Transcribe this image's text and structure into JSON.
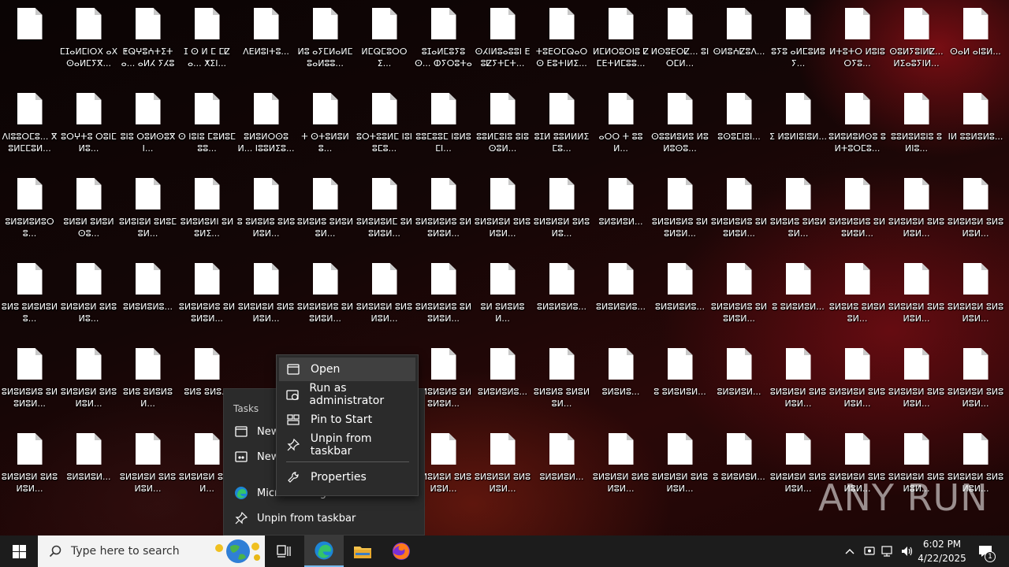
{
  "desktop": {
    "rows": [
      [
        "",
        "ⵎⵊⴰⵍⵎⵏⵔⵝ ⴰⵝⵙⴰⵍⵎⵢⴳ...",
        "ⵟⵕⵖⵓⵄⵜⵉⵜⴰ... ⴰⵍⵃ ⵢⵃⵓⵃⵕ...",
        "ⵊ ⵙ ⵍ ⵎ ⵎⵇⴰ... ⵅⵉⵏ...",
        "ⴷⴹⵍⵓⵏⵜⵓ...",
        "ⵍⵓ ⴰⵢⵎⵍⴰⵍⵎⵓⴰⵍⵓⵓ...",
        "ⵍⵎⵕⵎⵓⵔⵔⵉ...",
        "ⵓⵊⴰⵍⵎⵓⵢⵓⵙ... ⵀⵢⵔⵓⵜⴰⵍ...",
        "ⵙⵃⵏⵍⵓⴰⵓⵓⵏ ⴹⵓⵇⵢⵜⵎⵜ...",
        "ⵜⵓⴹⵔⵎⵕⴰⵔⵙ ⴹⵓⵜⵏⵍⵉ...",
        "ⵍⵎⵍⵔⵓⵔⵏⵓ ⵇⵎⴹⵜⵍⵎⵓⵓ...",
        "ⵍⵙⵓⴹⵔⵇ... ⵓⵏⵔⵎⵍ...",
        "ⵙⵍⵓⵄⵇⵓⴷ...",
        "ⵓⵢⵓ ⴰⵍⵎⵓⵍⵓⵢ...",
        "ⵍⵜⵓⵜⵔ ⵍⵓⵏⵓⵔⵢⵓ...",
        "ⵙⵓⵍⵢⵓⵏⵍⵇ... ⵍⵉⴰⵓⵢⵏⵍ...",
        "ⵙⴰⵍ ⴰⵏⵓⵍ..."
      ],
      [
        "ⴷⵏⵓⵓⵔⵎⵓ... ⴳⵓⵍⵎⵎⵓⵍ...",
        "ⵓⵔⵖⵜⵓ ⵔⵓⵏⵎⵍⵓ...",
        "ⵓⵏⵓ ⵔⵓⵍⵙⵓⴳⵏ...",
        "ⵙ ⵏⵓⵏⵓ ⵎⵓⵍⵓⵎⵓⵓ...",
        "ⵓⵍⵓⵍⵔⵙⵓⵍ... ⵏⵓⵓⵍⵉⵓ...",
        "ⵜ ⵙⵜⵓⵍⵓⵍⵓ...",
        "ⵓⵔⵜⵓⵓⵍⵎ ⵏⵓⵏⵓⵎⵓ...",
        "ⵓⵓⵎⵓⵓⵎ ⵏⵓⵍⵓⵎⵏ...",
        "ⵓⵓⵍⵎⵓⵏⵓ ⵓⵏⵓⵙⵓⵍ...",
        "ⵓⵊⵍ ⵓⵓⵍⵍⵍⵉⵎⵓ...",
        "ⴰⵔⵔ ⵜ ⵓⵓⵍ...",
        "ⵙⵓⵓⵍⵓⵍⵓ ⵍⵓⵍⵓⵙⵓ...",
        "ⵓⵙⵓⵎⵏⵓⵏ...",
        "ⵉ ⵍⵓⵍⵏⵓⵏⵓⵍ...",
        "ⵓⵍⵓⵍⵓⵍⵙⵓ ⵓⵍⵜⵓⵔⵎⵓ...",
        "ⵓⵓⵍⵓⵍⵓⵏⵓ ⵓ ⵍⵏⵓ...",
        "ⵏⵍ ⵓⵓⵍⵓⵍⵓ..."
      ],
      [
        "ⵓⵍⵓⵍⵓⵍⵓⵔⵓ...",
        "ⵓⵍⵓⵍ ⵓⵍⵓⵍⵙⵓ...",
        "ⵓⵍⵓⵏⵓⵍ ⵓⵍⵓⵎⵓⵍ...",
        "ⵓⵍⵓⵍⵓⵍⵏ ⵓⵍⵓⵍⵉ...",
        "ⵓ ⵓⵍⵓⵍⵓ ⵓⵍⵓⵍⵓⵍ...",
        "ⵓⵍⵓⵍⵓ ⵓⵍⵓⵍⵓⵍ...",
        "ⵓⵍⵓⵍⵓⵍⵎ ⵓⵍⵓⵍⵓⵍ...",
        "ⵓⵍⵓⵍⵓⵍⵓ ⵓⵍⵓⵍⵓⵍ...",
        "ⵓⵍⵓⵍⵓⵍ ⵓⵍⵓⵍⵓⵍ...",
        "ⵓⵍⵓⵍⵓⵍ ⵓⵍⵓⵍⵓ...",
        "ⵓⵍⵓⵍⵓⵍ...",
        "ⵓⵍⵓⵍⵓⵍⵓ ⵓⵍⵓⵍⵓⵍ...",
        "ⵓⵍⵓⵍⵓⵍⵓ ⵓⵍⵓⵍⵓⵍ...",
        "ⵓⵍⵓⵍⵓ ⵓⵍⵓⵍⵓⵍ...",
        "ⵓⵍⵓⵍⵓⵍⵓ ⵓⵍⵓⵍⵓⵍ...",
        "ⵓⵍⵓⵍⵓⵍ ⵓⵍⵓⵍⵓⵍ...",
        "ⵓⵍⵓⵍⵓⵍ ⵓⵍⵓⵍⵓⵍ..."
      ],
      [
        "ⵓⵍⵓ ⵓⵍⵓⵍⵓⵍⵓ...",
        "ⵓⵍⵓⵍⵓⵍ ⵓⵍⵓⵍⵓ...",
        "ⵓⵍⵓⵍⵓⵍⵓ...",
        "ⵓⵍⵓⵍⵓⵍⵓ ⵓⵍⵓⵍⵓⵍ...",
        "ⵓⵍⵓⵍⵓⵍ ⵓⵍⵓⵍⵓⵍ...",
        "ⵓⵍⵓⵍⵓⵍⵓ ⵓⵍⵓⵍⵓⵍ...",
        "ⵓⵍⵓⵍⵓⵍ ⵓⵍⵓⵍⵓⵍ...",
        "ⵓⵍⵓⵍⵓⵍⵓ ⵓⵍⵓⵍⵓⵍ...",
        "ⵓⵍ ⵓⵍⵓⵍⵓⵍ...",
        "ⵓⵍⵓⵍⵓⵍⵓ...",
        "ⵓⵍⵓⵍⵓⵍⵓ...",
        "ⵓⵍⵓⵍⵓⵍⵓ...",
        "ⵓⵍⵓⵍⵓⵍⵓ ⵓⵍⵓⵍⵓⵍ...",
        "ⵓ ⵓⵍⵓⵍⵓⵍ...",
        "ⵓⵍⵓⵍⵓ ⵓⵍⵓⵍⵓⵍ...",
        "ⵓⵍⵓⵍⵓⵍ ⵓⵍⵓⵍⵓⵍ...",
        "ⵓⵍⵓⵍⵓⵍ ⵓⵍⵓⵍⵓⵍ..."
      ],
      [
        "ⵓⵍⵓⵍⵓⵍⵓ ⵓⵍⵓⵍⵓⵍ...",
        "ⵓⵍⵓⵍⵓⵍ ⵓⵍⵓⵍⵓⵍ...",
        "ⵓⵍⵓ ⵓⵍⵓⵍⵓⵍ...",
        "ⵓⵍⵓ ⵓⵍⵓ...",
        "",
        "",
        "",
        "ⵓⵍⵓⵍⵓⵍⵓ ⵓⵍⵓⵍⵓⵍ...",
        "ⵓⵍⵓⵍⵓⵍⵓ...",
        "ⵓⵍⵓⵍⵓ ⵓⵍⵓⵍⵓⵍ...",
        "ⵓⵍⵓⵍⵓ...",
        "ⵓ ⵓⵍⵓⵍⵓⵍ...",
        "ⵓⵍⵓⵍⵓⵍ...",
        "ⵓⵍⵓⵍⵓⵍ ⵓⵍⵓⵍⵓⵍ...",
        "ⵓⵍⵓⵍⵓⵍ ⵓⵍⵓⵍⵓⵍ...",
        "ⵓⵍⵓⵍⵓⵍ ⵓⵍⵓⵍⵓⵍ...",
        "ⵓⵍⵓⵍⵓⵍ ⵓⵍⵓⵍⵓⵍ..."
      ],
      [
        "ⵓⵍⵓⵍⵓⵍ ⵓⵍⵓⵍⵓⵍ...",
        "ⵓⵍⵓⵍⵓⵍ...",
        "ⵓⵍⵓⵍⵓⵍ ⵓⵍⵓⵍⵓⵍ...",
        "ⵓⵍⵓⵍⵓⵍ ⵓⵍⵓⵍ...",
        "",
        "",
        "",
        "ⵓⵍⵓⵍⵓⵍ ⵓⵍⵓⵍⵓⵍ...",
        "ⵓⵍⵓⵍⵓⵍ ⵓⵍⵓⵍⵓⵍ...",
        "ⵓⵍⵓⵍⵓⵍ...",
        "ⵓⵍⵓⵍⵓⵍ ⵓⵍⵓⵍⵓⵍ...",
        "ⵓⵍⵓⵍⵓⵍ ⵓⵍⵓⵍⵓⵍ...",
        "ⵓ ⵓⵍⵓⵍⵓⵍ...",
        "ⵓⵍⵓⵍⵓⵍ ⵓⵍⵓⵍⵓⵍ...",
        "ⵓⵍⵓⵍⵓⵍ ⵓⵍⵓⵍⵓⵍ...",
        "ⵓⵍⵓⵍⵓⵍ ⵓⵍⵓⵍⵓⵍ...",
        "ⵓⵍⵓⵍⵓⵍ ⵓⵍⵓⵍⵓⵍ..."
      ]
    ]
  },
  "jumplist": {
    "header": "Tasks",
    "items": [
      {
        "label": "New",
        "icon": "window-icon"
      },
      {
        "label": "New",
        "icon": "inprivate-window-icon"
      },
      {
        "label": "Microsoft Edge",
        "icon": "edge-icon"
      },
      {
        "label": "Unpin from taskbar",
        "icon": "unpin-icon"
      }
    ]
  },
  "context_menu": {
    "items": [
      {
        "label": "Open",
        "icon": "window-icon"
      },
      {
        "label": "Run as administrator",
        "icon": "shield-icon"
      },
      {
        "label": "Pin to Start",
        "icon": "pin-start-icon"
      },
      {
        "label": "Unpin from taskbar",
        "icon": "unpin-icon"
      },
      {
        "label": "Properties",
        "icon": "wrench-icon"
      }
    ]
  },
  "taskbar": {
    "search_placeholder": "Type here to search",
    "time": "6:02 PM",
    "date": "4/22/2025",
    "notification_count": "1"
  },
  "watermark": "ANY RUN"
}
